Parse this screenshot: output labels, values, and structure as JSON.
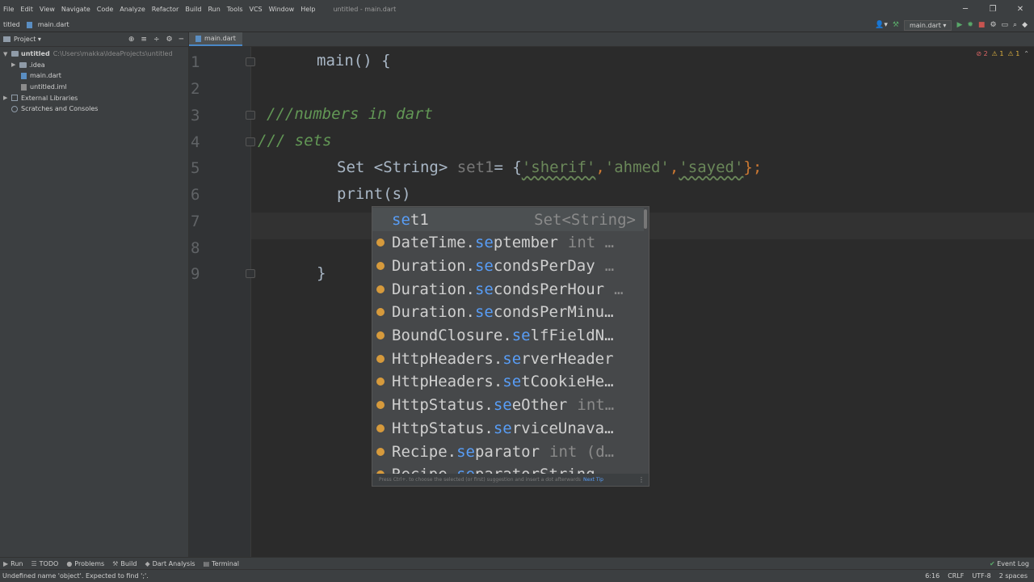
{
  "menu": {
    "items": [
      "File",
      "Edit",
      "View",
      "Navigate",
      "Code",
      "Analyze",
      "Refactor",
      "Build",
      "Run",
      "Tools",
      "VCS",
      "Window",
      "Help"
    ],
    "window_title": "untitled - main.dart"
  },
  "window_controls": [
    "─",
    "❐",
    "✕"
  ],
  "navbar": {
    "project": "titled",
    "file": "main.dart"
  },
  "run_toolbar": {
    "config": "main.dart ▾"
  },
  "project_panel": {
    "title": "Project ▾",
    "tree": [
      {
        "label": "untitled",
        "path": "C:\\Users\\makka\\IdeaProjects\\untitled",
        "level": 0
      },
      {
        "label": ".idea",
        "level": 1
      },
      {
        "label": "main.dart",
        "level": 1
      },
      {
        "label": "untitled.iml",
        "level": 1
      },
      {
        "label": "External Libraries",
        "level": 0
      },
      {
        "label": "Scratches and Consoles",
        "level": 0
      }
    ]
  },
  "editor": {
    "tab": "main.dart",
    "inspections": {
      "errors": "2",
      "warnings": "1",
      "weak": "1"
    },
    "line_numbers": [
      "1",
      "2",
      "3",
      "4",
      "5",
      "6",
      "7",
      "8",
      "9"
    ],
    "lines": {
      "l1": "main() {",
      "l3": "///numbers in dart",
      "l4": "/// sets",
      "l5_a": "Set <String> ",
      "l5_var": "set1",
      "l5_b": "= {",
      "l5_s1": "'sherif'",
      "l5_s2": "'ahmed'",
      "l5_s3": "'sayed'",
      "l5_end": "};",
      "comma": ",",
      "l6": "print(s)",
      "l9": "}"
    }
  },
  "completion": {
    "items": [
      {
        "prefix": "",
        "match": "se",
        "rest": "t1",
        "tail": "Set<String>",
        "icon": "none"
      },
      {
        "prefix": "DateTime.",
        "match": "se",
        "rest": "ptember",
        "tail": "int …",
        "icon": "field-icon"
      },
      {
        "prefix": "Duration.",
        "match": "se",
        "rest": "condsPerDay",
        "tail": "…",
        "icon": "field-icon"
      },
      {
        "prefix": "Duration.",
        "match": "se",
        "rest": "condsPerHour",
        "tail": "…",
        "icon": "field-icon"
      },
      {
        "prefix": "Duration.",
        "match": "se",
        "rest": "condsPerMinu…",
        "tail": "",
        "icon": "field-icon"
      },
      {
        "prefix": "BoundClosure.",
        "match": "se",
        "rest": "lfFieldN…",
        "tail": "",
        "icon": "method-icon"
      },
      {
        "prefix": "HttpHeaders.",
        "match": "se",
        "rest": "rverHeader",
        "tail": "",
        "icon": "field-icon"
      },
      {
        "prefix": "HttpHeaders.",
        "match": "se",
        "rest": "tCookieHe…",
        "tail": "",
        "icon": "field-icon"
      },
      {
        "prefix": "HttpStatus.",
        "match": "se",
        "rest": "eOther",
        "tail": "int…",
        "icon": "field-icon"
      },
      {
        "prefix": "HttpStatus.",
        "match": "se",
        "rest": "rviceUnava…",
        "tail": "",
        "icon": "field-icon"
      },
      {
        "prefix": "Recipe.",
        "match": "se",
        "rest": "parator",
        "tail": "int (d…",
        "icon": "field-icon"
      },
      {
        "prefix": "Recipe.",
        "match": "se",
        "rest": "paratorString",
        "tail": "",
        "icon": "field-icon"
      }
    ],
    "hint": "Press Ctrl+. to choose the selected (or first) suggestion and insert a dot afterwards",
    "hint_link": "Next Tip"
  },
  "toolwindows": [
    "Run",
    "TODO",
    "Problems",
    "Build",
    "Dart Analysis",
    "Terminal"
  ],
  "event_log": "Event Log",
  "status": {
    "message": "Undefined name 'object'. Expected to find ';'.",
    "position": "6:16",
    "line_sep": "CRLF",
    "encoding": "UTF-8",
    "indent": "2 spaces"
  }
}
